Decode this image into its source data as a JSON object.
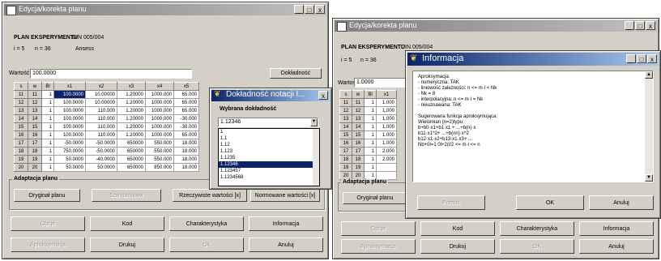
{
  "left_window": {
    "title": "Edycja/korekta planu",
    "plan_label": "PLAN EKSPERYMENTU",
    "plan_code": "DIN 005/004",
    "i_label": "i = 5",
    "n_label": "n = 36",
    "ansys": "Ansess",
    "value_label": "Wartość:",
    "value": "100.0000",
    "accuracy_button": "Dokładność",
    "table": {
      "headers": [
        "s",
        "w",
        "Bl",
        "x1",
        "x2",
        "x3",
        "x4",
        "x5"
      ],
      "rows": [
        [
          "11",
          "11",
          "1",
          "100.0000",
          "10.00000",
          "1.20000",
          "1000.000",
          "65.000"
        ],
        [
          "12",
          "12",
          "1",
          "100.0000",
          "10.00000",
          "1.20000",
          "1000.000",
          "65.000"
        ],
        [
          "13",
          "13",
          "1",
          "100.0000",
          "110.000",
          "1.20000",
          "1000.000",
          "65.000"
        ],
        [
          "14",
          "14",
          "1",
          "100.0000",
          "110.000",
          "1.20000",
          "1000.000",
          "-30.000"
        ],
        [
          "15",
          "15",
          "1",
          "100.0000",
          "110.000",
          "1.20000",
          "1000.000",
          "-30.000"
        ],
        [
          "16",
          "16",
          "1",
          "100.0000",
          "110.000",
          "1.20000",
          "1000.000",
          "65.000"
        ],
        [
          "17",
          "17",
          "1",
          "-50.0000",
          "-50.0000",
          "650000",
          "550.000",
          "18.000"
        ],
        [
          "18",
          "18",
          "1",
          "750.0000",
          "-50.0000",
          "650000",
          "550.000",
          "18.000"
        ],
        [
          "19",
          "19",
          "1",
          "50.0000",
          "-40.0000",
          "650000",
          "550.000",
          "18.000"
        ],
        [
          "20",
          "20",
          "1",
          "50.0000",
          "50.0000",
          "650000",
          "850.000",
          "18.000"
        ]
      ]
    },
    "adaptation_label": "Adaptacja planu",
    "adapt_buttons": [
      "Oryginał planu",
      "Standardowa",
      "Rzeczywiste wartości [x]",
      "Normowane wartości [x]"
    ],
    "bottom_row1": [
      "Opcje",
      "Kod",
      "Charakterystyka",
      "Informacja"
    ],
    "bottom_row2": [
      "Aproksymacja",
      "Drukuj",
      "OK",
      "Anuluj"
    ]
  },
  "accuracy_popup": {
    "title": "Dokładność notacji l...",
    "label": "Wybrana dokładność",
    "selected": "1.12346",
    "options": [
      "1",
      "1.1",
      "1.12",
      "1.123",
      "1.1235",
      "1.12346",
      "1.123457",
      "1.1234568"
    ]
  },
  "right_window": {
    "title": "Edycja/korekta planu",
    "plan_label": "PLAN EKSPERYMENTU",
    "plan_code": "DIN 005/004",
    "i_label": "i = 5",
    "n_label": "n = 36",
    "value_label": "Wartość:",
    "value": "1.0000",
    "table_headers": [
      "s",
      "w",
      "Bl",
      "x1"
    ],
    "table_rows": [
      [
        "11",
        "11",
        "1",
        "1.000"
      ],
      [
        "12",
        "12",
        "1",
        "1.000"
      ],
      [
        "13",
        "13",
        "1",
        "1.000"
      ],
      [
        "14",
        "14",
        "1",
        "1.000"
      ],
      [
        "15",
        "15",
        "1",
        "1.000"
      ],
      [
        "16",
        "16",
        "1",
        "1.000"
      ],
      [
        "17",
        "17",
        "1",
        "2.000"
      ],
      [
        "18",
        "18",
        "1",
        "2.000"
      ],
      [
        "19",
        "19",
        "1",
        ""
      ],
      [
        "20",
        "20",
        "1",
        ""
      ]
    ],
    "adaptation_label": "Adaptacja planu",
    "adapt_button": "Oryginał planu",
    "bottom_row1": [
      "Opcje",
      "Kod",
      "Charakterystyka",
      "Informacja"
    ],
    "bottom_row2": [
      "Aproksymacja",
      "Drukuj",
      "OK",
      "Anuluj"
    ]
  },
  "info_dialog": {
    "title": "Informacja",
    "lines": [
      "Aproksymacja:",
      "- numeryczna: TAK",
      "- liniowość zależności: n <= m·l < Nk",
      "- Nk = 8",
      "- interpolacyjna: n <= m·l = Nk",
      "- nieuznawana: TAK",
      "",
      "Sugerowana funkcja aproksymująca:",
      "Wielomian (n=2)typu:",
      "b+b0·x1+b1·x1 + ...+b(n)·x",
      "b11·x1^2+ ...+b(nn)·x^2",
      "b12·x1·x2+b13·x1·x3+ ...",
      "Nb+0l=1 0l+2(l/2 <= m·l <= n"
    ],
    "buttons": [
      "Pomoc",
      "OK",
      "Anuluj"
    ]
  }
}
